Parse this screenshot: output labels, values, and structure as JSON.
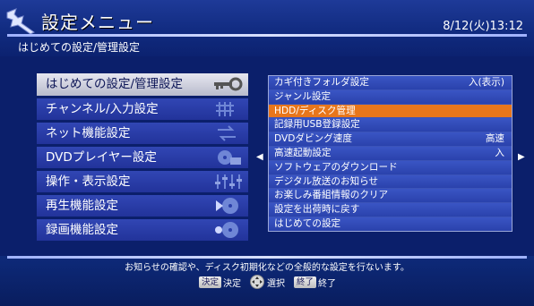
{
  "header": {
    "title": "設定メニュー",
    "datetime": "8/12(火)13:12",
    "breadcrumb": "はじめての設定/管理設定"
  },
  "left_menu": {
    "items": [
      {
        "label": "はじめての設定/管理設定",
        "icon": "key-icon",
        "selected": true
      },
      {
        "label": "チャンネル/入力設定",
        "icon": "antenna-icon",
        "selected": false
      },
      {
        "label": "ネット機能設定",
        "icon": "network-icon",
        "selected": false
      },
      {
        "label": "DVDプレイヤー設定",
        "icon": "dvd-player-icon",
        "selected": false
      },
      {
        "label": "操作・表示設定",
        "icon": "sliders-icon",
        "selected": false
      },
      {
        "label": "再生機能設定",
        "icon": "disc-play-icon",
        "selected": false
      },
      {
        "label": "録画機能設定",
        "icon": "disc-record-icon",
        "selected": false
      }
    ]
  },
  "right_list": {
    "items": [
      {
        "label": "カギ付きフォルダ設定",
        "value": "入(表示)",
        "selected": false
      },
      {
        "label": "ジャンル設定",
        "value": "",
        "selected": false
      },
      {
        "label": "HDD/ディスク管理",
        "value": "",
        "selected": true
      },
      {
        "label": "記録用USB登録設定",
        "value": "",
        "selected": false
      },
      {
        "label": "DVDダビング速度",
        "value": "高速",
        "selected": false
      },
      {
        "label": "高速起動設定",
        "value": "入",
        "selected": false
      },
      {
        "label": "ソフトウェアのダウンロード",
        "value": "",
        "selected": false
      },
      {
        "label": "デジタル放送のお知らせ",
        "value": "",
        "selected": false
      },
      {
        "label": "お楽しみ番組情報のクリア",
        "value": "",
        "selected": false
      },
      {
        "label": "設定を出荷時に戻す",
        "value": "",
        "selected": false
      },
      {
        "label": "はじめての設定",
        "value": "",
        "selected": false
      }
    ]
  },
  "footer": {
    "hint": "お知らせの確認や、ディスク初期化などの全般的な設定を行ないます。",
    "controls": {
      "enter_key": "決定",
      "enter_label": "決定",
      "select_label": "選択",
      "exit_key": "終了",
      "exit_label": "終了"
    }
  },
  "colors": {
    "background": "#0b1f6b",
    "highlight": "#e8761b",
    "menu_item": "#2a3ea8"
  }
}
